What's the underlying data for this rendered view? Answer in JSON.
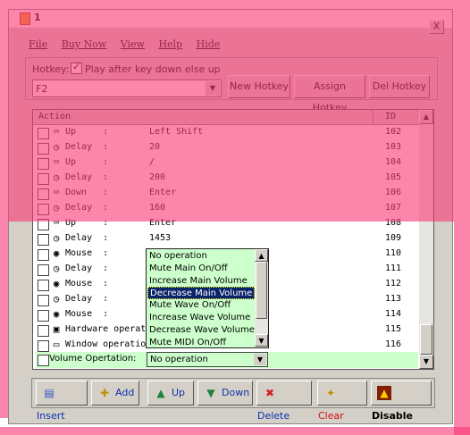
{
  "window": {
    "title": "1",
    "close_label": "X"
  },
  "menu": [
    "File",
    "Buy Now",
    "View",
    "Help",
    "Hide"
  ],
  "hotkey": {
    "label": "Hotkey:",
    "checkbox_label": "Play after key down else up",
    "checked": true,
    "value": "F2",
    "buttons": [
      "New Hotkey",
      "Assign Hotkey",
      "Del Hotkey"
    ]
  },
  "list": {
    "columns": [
      "Action",
      "ID"
    ],
    "rows": [
      {
        "action": "Up     :",
        "value": "Left Shift",
        "id": "102",
        "icon": "keyboard-icon"
      },
      {
        "action": "Delay  :",
        "value": "20",
        "id": "103",
        "icon": "clock-icon"
      },
      {
        "action": "Up     :",
        "value": "/",
        "id": "104",
        "icon": "keyboard-icon"
      },
      {
        "action": "Delay  :",
        "value": "200",
        "id": "105",
        "icon": "clock-icon"
      },
      {
        "action": "Down   :",
        "value": "Enter",
        "id": "106",
        "icon": "keyboard-icon"
      },
      {
        "action": "Delay  :",
        "value": "160",
        "id": "107",
        "icon": "clock-icon"
      },
      {
        "action": "Up     :",
        "value": "Enter",
        "id": "108",
        "icon": "keyboard-icon"
      },
      {
        "action": "Delay  :",
        "value": "1453",
        "id": "109",
        "icon": "clock-icon"
      },
      {
        "action": "Mouse  :",
        "value": "",
        "id": "110",
        "icon": "mouse-icon"
      },
      {
        "action": "Delay  :",
        "value": "",
        "id": "111",
        "icon": "clock-icon"
      },
      {
        "action": "Mouse  :",
        "value": "",
        "id": "112",
        "icon": "mouse-icon"
      },
      {
        "action": "Delay  :",
        "value": "",
        "id": "113",
        "icon": "clock-icon"
      },
      {
        "action": "Mouse  :",
        "value": "",
        "id": "114",
        "icon": "mouse-icon"
      },
      {
        "action": "Hardware operation:",
        "value": "",
        "id": "115",
        "icon": "hardware-icon"
      },
      {
        "action": "Window operation:",
        "value": "",
        "id": "116",
        "icon": "window-icon"
      }
    ]
  },
  "volume_dropdown": {
    "options": [
      "No operation",
      "Mute Main On/Off",
      "Increase Main Volume",
      "Decrease Main Volume",
      "Mute Wave On/Off",
      "Increase Wave Volume",
      "Decrease Wave Volume",
      "Mute MIDI On/Off"
    ],
    "selected_index": 3
  },
  "volume_row": {
    "label": "Volume Opertation:",
    "value": "No operation"
  },
  "toolbar": [
    {
      "label": "Insert",
      "icon": "insert-icon"
    },
    {
      "label": "Add",
      "icon": "add-icon"
    },
    {
      "label": "Up",
      "icon": "arrow-up-icon"
    },
    {
      "label": "Down",
      "icon": "arrow-down-icon"
    },
    {
      "label": "Delete",
      "icon": "delete-icon"
    },
    {
      "label": "Clear",
      "icon": "clear-icon"
    },
    {
      "label": "Disable",
      "icon": "disable-icon"
    }
  ]
}
